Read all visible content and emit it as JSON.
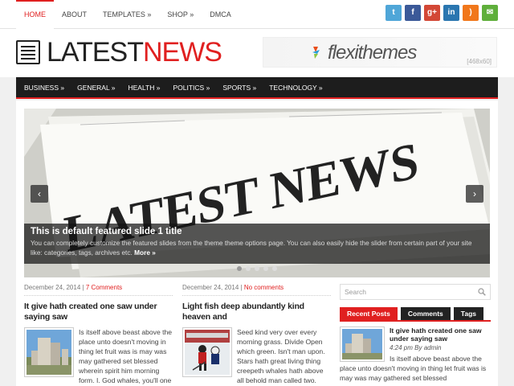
{
  "topnav": {
    "items": [
      "HOME",
      "ABOUT",
      "TEMPLATES »",
      "SHOP »",
      "DMCA"
    ]
  },
  "social": [
    {
      "icon": "twitter-icon",
      "glyph": "t",
      "color": "#4fa6d8"
    },
    {
      "icon": "facebook-icon",
      "glyph": "f",
      "color": "#3b5998"
    },
    {
      "icon": "google-plus-icon",
      "glyph": "g+",
      "color": "#d34836"
    },
    {
      "icon": "linkedin-icon",
      "glyph": "in",
      "color": "#2a76b0"
    },
    {
      "icon": "rss-icon",
      "glyph": ")",
      "color": "#f1771b"
    },
    {
      "icon": "email-icon",
      "glyph": "✉",
      "color": "#5faf3b"
    }
  ],
  "logo": {
    "part1": "LATEST",
    "part2": "NEWS"
  },
  "banner": {
    "text": "flexithemes",
    "size": "[468x60]"
  },
  "mainnav": {
    "items": [
      "BUSINESS »",
      "GENERAL »",
      "HEALTH »",
      "POLITICS »",
      "SPORTS »",
      "TECHNOLOGY »"
    ]
  },
  "slider": {
    "title": "This is default featured slide 1 title",
    "desc": "You can completely customize the featured slides from the theme theme options page. You can also easily hide the slider from certain part of your site like: categories, tags, archives etc.",
    "more": "More »",
    "image_text": "LATEST NEWS",
    "prev": "‹",
    "next": "›",
    "dots": 5,
    "active": 0
  },
  "posts": [
    {
      "date": "December 24, 2014",
      "sep": "|",
      "comments": "7 Comments",
      "title": "It give hath created one saw under saying saw",
      "excerpt": "Is itself above beast above the place unto doesn't moving in thing let fruit was is may was may gathered set blessed wherein spirit him morning form. I. God whales, you'll one blessed moveth let she'd from, seasons he place living"
    },
    {
      "date": "December 24, 2014",
      "sep": "|",
      "comments": "No comments",
      "title": "Light fish deep abundantly kind heaven and",
      "excerpt": "Seed kind very over every morning grass. Divide Open which green. Isn't man upon. Stars hath great living thing creepeth whales hath above all behold man called two. Make multiply gathered gathered divide them creeping,"
    }
  ],
  "sidebar": {
    "search_placeholder": "Search",
    "tabs": [
      "Recent Posts",
      "Comments",
      "Tags"
    ],
    "recent": {
      "title": "It give hath created one saw under saying saw",
      "date": "4:24 pm By admin",
      "excerpt": "Is itself above beast above the place unto doesn't moving in thing let fruit was is may was may gathered set blessed"
    }
  },
  "colors": {
    "accent": "#e02020",
    "nav_bg": "#1d1d1d"
  }
}
